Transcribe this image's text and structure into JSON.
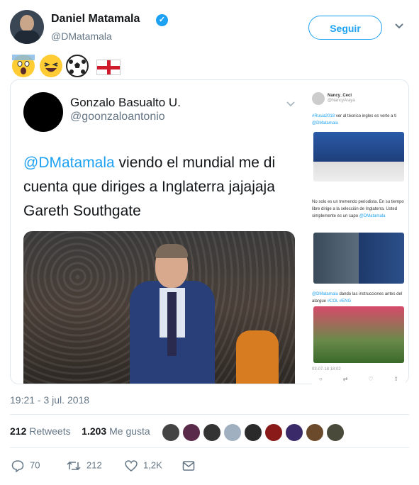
{
  "tweet": {
    "author_name": "Daniel Matamala",
    "author_handle": "@DMatamala",
    "follow_label": "Seguir",
    "timestamp": "19:21 - 3 jul. 2018",
    "retweets_count": "212",
    "retweets_label": "Retweets",
    "likes_count": "1.203",
    "likes_label": "Me gusta"
  },
  "quoted": {
    "name": "Gonzalo Basualto U.",
    "handle": "@goonzaloantonio",
    "mention": "@DMatamala",
    "text": " viendo el mundial me di cuenta que diriges a Inglaterra jajajaja Gareth Southgate"
  },
  "screenshot": {
    "user_name": "Nancy_Ceci",
    "user_handle": "@NancyAraya",
    "line1_tag": "#Rusia2018",
    "line1_text": " ver al técnico ingles es verte a ti ",
    "line1_mention": "@DMatamala",
    "line2_text": "No solo es un tremendo periodista. En su tiempo libre dirige a la selección de Inglaterra. Usted simplemente es un capo ",
    "line2_mention": "@DMatamala",
    "line3_mention": "@DMatamala",
    "line3_text": " dando las instrucciones antes del alargue ",
    "line3_tags": "#COL  #ENG",
    "date": "03-07-18 18:02"
  },
  "actions": {
    "reply_count": "70",
    "retweet_count": "212",
    "like_count": "1,2K"
  },
  "colors": {
    "accent": "#1da1f2",
    "muted": "#657786",
    "text": "#14171a"
  },
  "icons": [
    "verified-icon",
    "chevron-down-icon",
    "reply-icon",
    "retweet-icon",
    "heart-icon",
    "message-icon"
  ]
}
